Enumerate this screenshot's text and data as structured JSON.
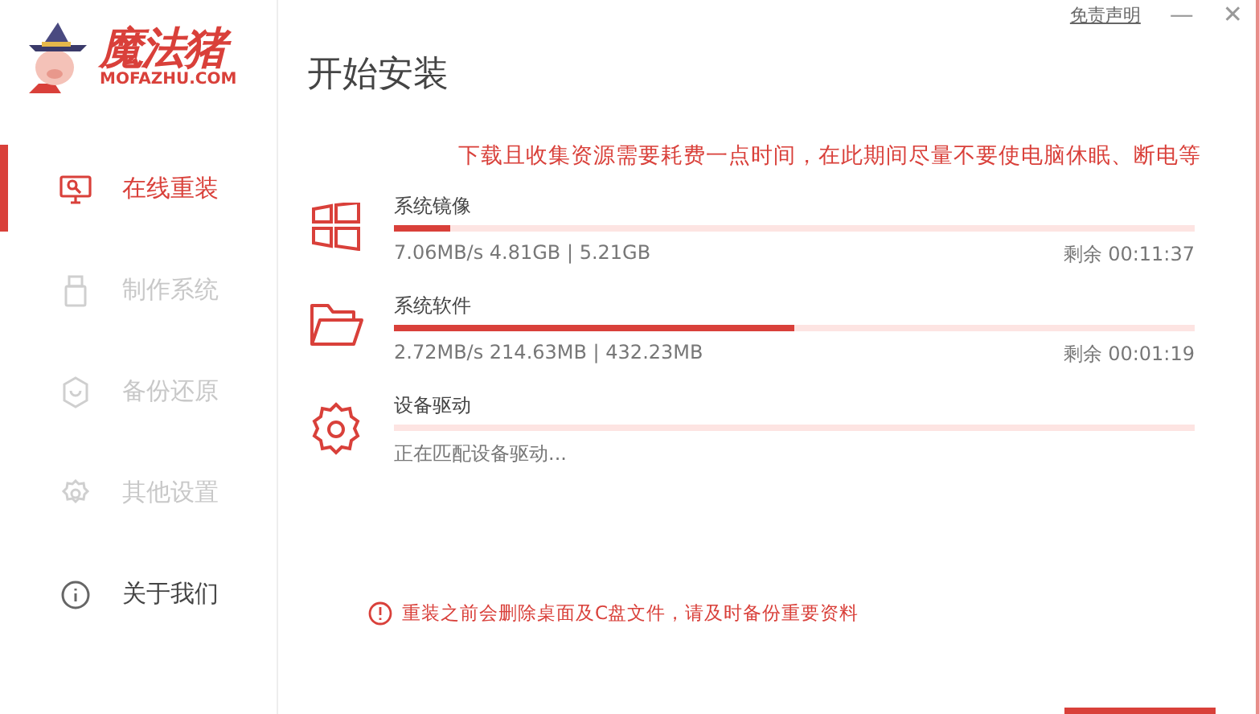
{
  "logo": {
    "name": "魔法猪",
    "domain": "MOFAZHU.COM"
  },
  "title": "开始安装",
  "top_links": {
    "disclaimer": "免责声明",
    "minimize": "—",
    "close": "✕"
  },
  "sidebar": {
    "items": [
      {
        "label": "在线重装",
        "kind": "monitor",
        "selected": true,
        "disabled": false
      },
      {
        "label": "制作系统",
        "kind": "usb",
        "selected": false,
        "disabled": true
      },
      {
        "label": "备份还原",
        "kind": "shield",
        "selected": false,
        "disabled": true
      },
      {
        "label": "其他设置",
        "kind": "gear",
        "selected": false,
        "disabled": true
      },
      {
        "label": "关于我们",
        "kind": "info",
        "selected": false,
        "disabled": false
      }
    ]
  },
  "notice": "下载且收集资源需要耗费一点时间，在此期间尽量不要使电脑休眠、断电等",
  "tasks": [
    {
      "name": "系统镜像",
      "kind": "windows",
      "level": 0.07,
      "detail": "7.06MB/s 4.81GB | 5.21GB",
      "remaining": "剩余 00:11:37"
    },
    {
      "name": "系统软件",
      "kind": "folder",
      "level": 0.5,
      "detail": "2.72MB/s 214.63MB | 432.23MB",
      "remaining": "剩余 00:01:19"
    },
    {
      "name": "设备驱动",
      "kind": "gear",
      "level": 0,
      "detail": "正在匹配设备驱动..."
    }
  ],
  "warning": "重装之前会删除桌面及C盘文件，请及时备份重要资料"
}
